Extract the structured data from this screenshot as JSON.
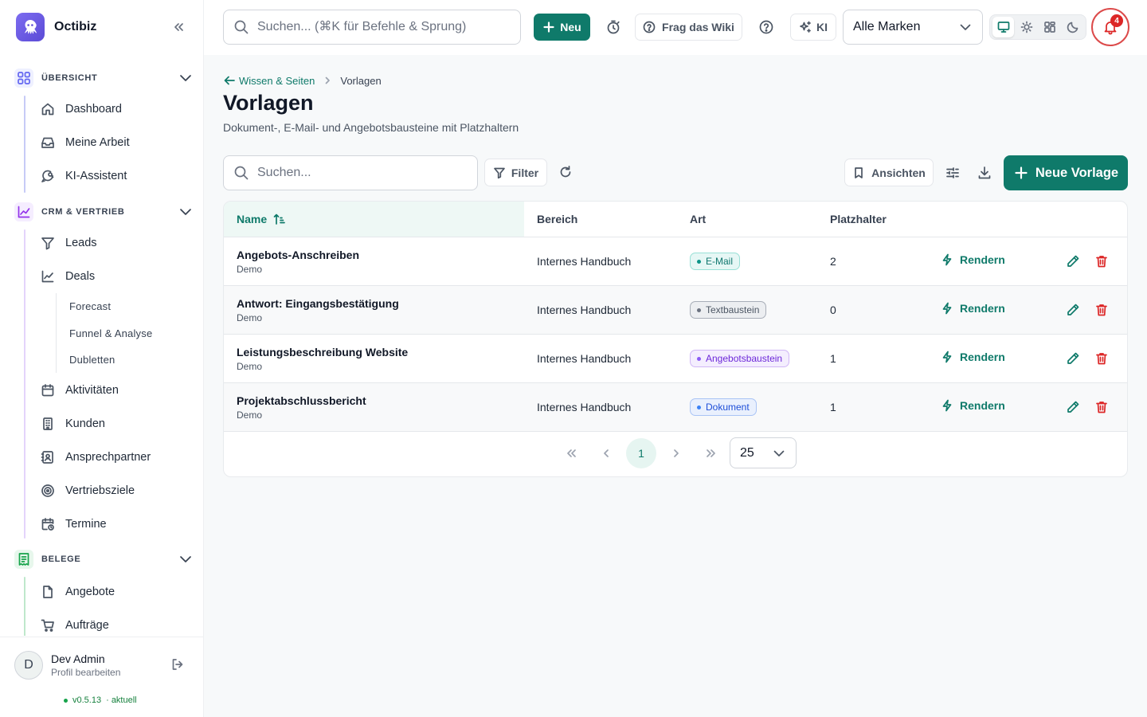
{
  "app": {
    "name": "Octibiz",
    "version": "v0.5.13",
    "version_status": "· aktuell"
  },
  "topbar": {
    "search_placeholder": "Suchen... (⌘K für Befehle & Sprung)",
    "new_label": "Neu",
    "wiki_label": "Frag das Wiki",
    "ki_label": "KI",
    "brand_select": "Alle Marken",
    "notification_count": "4"
  },
  "sidebar": {
    "sections": [
      {
        "label": "ÜBERSICHT",
        "items": [
          "Dashboard",
          "Meine Arbeit",
          "KI-Assistent"
        ]
      },
      {
        "label": "CRM & VERTRIEB",
        "items": [
          "Leads",
          "Deals",
          "Aktivitäten",
          "Kunden",
          "Ansprechpartner",
          "Vertriebsziele",
          "Termine"
        ],
        "deal_subitems": [
          "Forecast",
          "Funnel & Analyse",
          "Dubletten"
        ]
      },
      {
        "label": "BELEGE",
        "items": [
          "Angebote",
          "Aufträge"
        ]
      }
    ]
  },
  "user": {
    "initial": "D",
    "name": "Dev Admin",
    "subtitle": "Profil bearbeiten"
  },
  "breadcrumb": {
    "parent": "Wissen & Seiten",
    "current": "Vorlagen"
  },
  "page": {
    "title": "Vorlagen",
    "description": "Dokument-, E-Mail- und Angebotsbausteine mit Platzhaltern"
  },
  "toolbar": {
    "search_placeholder": "Suchen...",
    "filter_label": "Filter",
    "views_label": "Ansichten",
    "new_template_label": "Neue Vorlage"
  },
  "table": {
    "columns": [
      "Name",
      "Bereich",
      "Art",
      "Platzhalter"
    ],
    "action_label": "Rendern",
    "rows": [
      {
        "name": "Angebots-Anschreiben",
        "sub": "Demo",
        "area": "Internes Handbuch",
        "type": "E-Mail",
        "placeholders": "2"
      },
      {
        "name": "Antwort: Eingangsbestätigung",
        "sub": "Demo",
        "area": "Internes Handbuch",
        "type": "Textbaustein",
        "placeholders": "0"
      },
      {
        "name": "Leistungsbeschreibung Website",
        "sub": "Demo",
        "area": "Internes Handbuch",
        "type": "Angebotsbaustein",
        "placeholders": "1"
      },
      {
        "name": "Projektabschlussbericht",
        "sub": "Demo",
        "area": "Internes Handbuch",
        "type": "Dokument",
        "placeholders": "1"
      }
    ]
  },
  "pagination": {
    "current_page": "1",
    "page_size": "25"
  },
  "colors": {
    "primary": "#0f7a6a",
    "badge_email": "#0d9488",
    "badge_text": "#6b7280",
    "badge_offer": "#7c3aed",
    "badge_doc": "#2563eb",
    "danger": "#dc2626"
  }
}
